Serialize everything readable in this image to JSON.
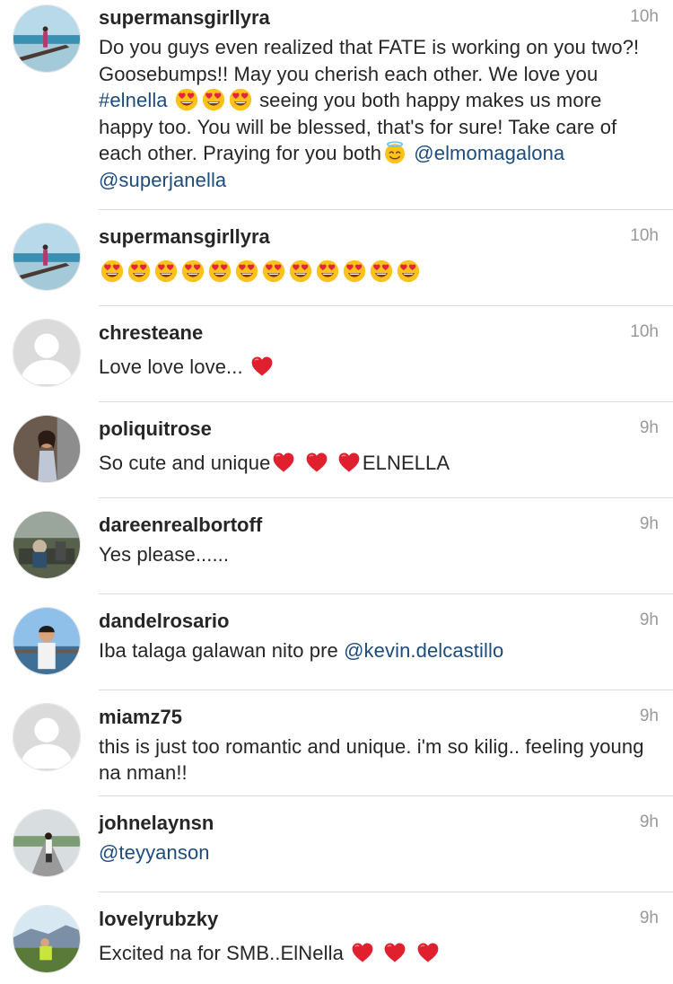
{
  "comments": [
    {
      "username": "supermansgirllyra",
      "time": "10h",
      "avatar": "beach-photo",
      "t1": "Do you guys even realized that FATE is working on you two?! Goosebumps!! May you cherish each other. We love you ",
      "tag": "#elnella",
      "t2": " seeing you both happy makes us more happy too. You will be blessed, that's for sure! Take care of each other. Praying for you both",
      "m1": "@elmomagalona",
      "m2": "@superjanella"
    },
    {
      "username": "supermansgirllyra",
      "time": "10h",
      "avatar": "beach-photo"
    },
    {
      "username": "chresteane",
      "time": "10h",
      "avatar": "default-avatar",
      "t1": "Love love love... "
    },
    {
      "username": "poliquitrose",
      "time": "9h",
      "avatar": "woman-photo",
      "t1": "So cute and unique",
      "t2": "ELNELLA"
    },
    {
      "username": "dareenrealbortoff",
      "time": "9h",
      "avatar": "park-photo",
      "t1": "Yes please......"
    },
    {
      "username": "dandelrosario",
      "time": "9h",
      "avatar": "pier-photo",
      "t1": "Iba talaga galawan nito pre ",
      "m1": "@kevin.delcastillo"
    },
    {
      "username": "miamz75",
      "time": "9h",
      "avatar": "default-avatar",
      "t1": "this is just too romantic and unique. i'm so kilig.. feeling young na nman!!"
    },
    {
      "username": "johnelaynsn",
      "time": "9h",
      "avatar": "road-photo",
      "m1": "@teyyanson"
    },
    {
      "username": "lovelyrubzky",
      "time": "9h",
      "avatar": "hilltop-photo",
      "t1": "Excited na for SMB..ElNella"
    }
  ],
  "colors": {
    "link": "#1c4b7e",
    "timestamp": "#999999",
    "divider": "#dbdbdb"
  }
}
